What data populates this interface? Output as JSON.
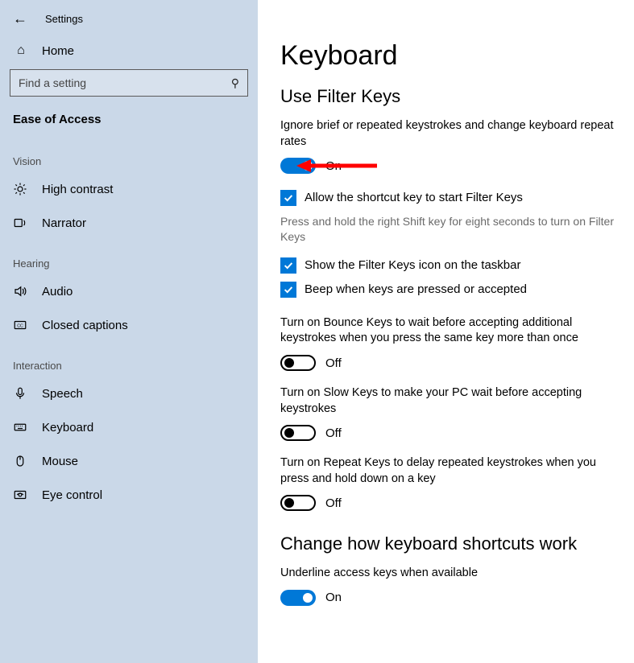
{
  "header": {
    "settings": "Settings",
    "home": "Home",
    "search_placeholder": "Find a setting",
    "section": "Ease of Access"
  },
  "groups": {
    "vision": "Vision",
    "hearing": "Hearing",
    "interaction": "Interaction"
  },
  "nav": {
    "high_contrast": "High contrast",
    "narrator": "Narrator",
    "audio": "Audio",
    "closed_captions": "Closed captions",
    "speech": "Speech",
    "keyboard": "Keyboard",
    "mouse": "Mouse",
    "eye_control": "Eye control"
  },
  "page": {
    "title": "Keyboard",
    "filter_heading": "Use Filter Keys",
    "filter_desc": "Ignore brief or repeated keystrokes and change keyboard repeat rates",
    "filter_toggle_state": "On",
    "allow_shortcut": "Allow the shortcut key to start Filter Keys",
    "allow_shortcut_hint": "Press and hold the right Shift key for eight seconds to turn on Filter Keys",
    "show_icon": "Show the Filter Keys icon on the taskbar",
    "beep": "Beep when keys are pressed or accepted",
    "bounce_desc": "Turn on Bounce Keys to wait before accepting additional keystrokes when you press the same key more than once",
    "bounce_state": "Off",
    "slow_desc": "Turn on Slow Keys to make your PC wait before accepting keystrokes",
    "slow_state": "Off",
    "repeat_desc": "Turn on Repeat Keys to delay repeated keystrokes when you press and hold down on a key",
    "repeat_state": "Off",
    "shortcuts_heading": "Change how keyboard shortcuts work",
    "underline_desc": "Underline access keys when available",
    "underline_state": "On"
  }
}
